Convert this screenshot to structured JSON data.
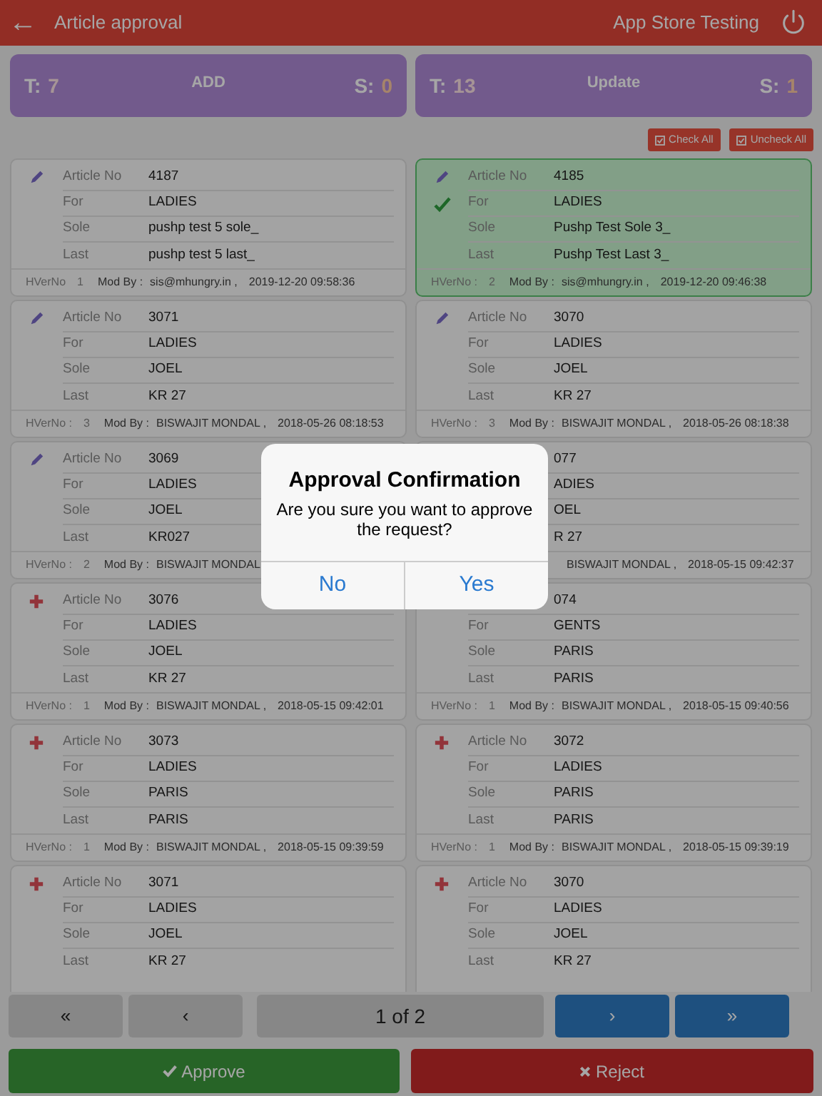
{
  "header": {
    "back": "←",
    "title": "Article approval",
    "user": "App Store Testing"
  },
  "stats": [
    {
      "t_label": "T:",
      "t_value": "7",
      "title": "ADD",
      "s_label": "S:",
      "s_value": "0"
    },
    {
      "t_label": "T:",
      "t_value": "13",
      "title": "Update",
      "s_label": "S:",
      "s_value": "1"
    }
  ],
  "actions": [
    "Check All",
    "Uncheck All"
  ],
  "articles": [
    {
      "kind": "pencil",
      "selected": false,
      "article_label": "Article No",
      "article_no": "4187",
      "rows": [
        {
          "label": "For",
          "value": "LADIES"
        },
        {
          "label": "Sole",
          "value": "pushp test 5 sole_"
        },
        {
          "label": "Last",
          "value": "pushp test 5 last_"
        }
      ],
      "footer": {
        "hver_label": "HVerNo",
        "hver": "1",
        "mod_label": "Mod By :",
        "mod_by": "sis@mhungry.in ,",
        "date": "2019-12-20 09:58:36"
      }
    },
    {
      "kind": "pencil",
      "selected": true,
      "article_label": "Article No",
      "article_no": "4185",
      "rows": [
        {
          "label": "For",
          "value": "LADIES"
        },
        {
          "label": "Sole",
          "value": "Pushp Test Sole 3_"
        },
        {
          "label": "Last",
          "value": "Pushp Test Last 3_"
        }
      ],
      "footer": {
        "hver_label": "HVerNo :",
        "hver": "2",
        "mod_label": "Mod By :",
        "mod_by": "sis@mhungry.in ,",
        "date": "2019-12-20 09:46:38"
      }
    },
    {
      "kind": "pencil",
      "selected": false,
      "article_label": "Article No",
      "article_no": "3071",
      "rows": [
        {
          "label": "For",
          "value": "LADIES"
        },
        {
          "label": "Sole",
          "value": "JOEL"
        },
        {
          "label": "Last",
          "value": "KR 27"
        }
      ],
      "footer": {
        "hver_label": "HVerNo :",
        "hver": "3",
        "mod_label": "Mod By :",
        "mod_by": "BISWAJIT MONDAL ,",
        "date": "2018-05-26 08:18:53"
      }
    },
    {
      "kind": "pencil",
      "selected": false,
      "article_label": "Article No",
      "article_no": "3070",
      "rows": [
        {
          "label": "For",
          "value": "LADIES"
        },
        {
          "label": "Sole",
          "value": "JOEL"
        },
        {
          "label": "Last",
          "value": "KR 27"
        }
      ],
      "footer": {
        "hver_label": "HVerNo :",
        "hver": "3",
        "mod_label": "Mod By :",
        "mod_by": "BISWAJIT MONDAL ,",
        "date": "2018-05-26 08:18:38"
      }
    },
    {
      "kind": "pencil",
      "selected": false,
      "article_label": "Article No",
      "article_no": "3069",
      "rows": [
        {
          "label": "For",
          "value": "LADIES"
        },
        {
          "label": "Sole",
          "value": "JOEL"
        },
        {
          "label": "Last",
          "value": "KR027"
        }
      ],
      "footer": {
        "hver_label": "HVerNo :",
        "hver": "2",
        "mod_label": "Mod By :",
        "mod_by": "BISWAJIT MONDAL"
      }
    },
    {
      "selected": false,
      "article_no": "077",
      "rows": [
        {
          "value": "ADIES"
        },
        {
          "value": "OEL"
        },
        {
          "value": "R 27"
        }
      ],
      "footer": {
        "mod_by": "BISWAJIT MONDAL ,",
        "date": "2018-05-15 09:42:37"
      }
    },
    {
      "kind": "plus",
      "selected": false,
      "article_label": "Article No",
      "article_no": "3076",
      "rows": [
        {
          "label": "For",
          "value": "LADIES"
        },
        {
          "label": "Sole",
          "value": "JOEL"
        },
        {
          "label": "Last",
          "value": "KR 27"
        }
      ],
      "footer": {
        "hver_label": "HVerNo :",
        "hver": "1",
        "mod_label": "Mod By :",
        "mod_by": "BISWAJIT MONDAL ,",
        "date": "2018-05-15 09:42:01"
      }
    },
    {
      "selected": false,
      "article_no": "074",
      "rows": [
        {
          "label": "For",
          "value": "GENTS"
        },
        {
          "label": "Sole",
          "value": "PARIS"
        },
        {
          "label": "Last",
          "value": "PARIS"
        }
      ],
      "footer": {
        "hver_label": "HVerNo :",
        "hver": "1",
        "mod_label": "Mod By :",
        "mod_by": "BISWAJIT MONDAL ,",
        "date": "2018-05-15 09:40:56"
      }
    },
    {
      "kind": "plus",
      "selected": false,
      "article_label": "Article No",
      "article_no": "3073",
      "rows": [
        {
          "label": "For",
          "value": "LADIES"
        },
        {
          "label": "Sole",
          "value": "PARIS"
        },
        {
          "label": "Last",
          "value": "PARIS"
        }
      ],
      "footer": {
        "hver_label": "HVerNo :",
        "hver": "1",
        "mod_label": "Mod By :",
        "mod_by": "BISWAJIT MONDAL ,",
        "date": "2018-05-15 09:39:59"
      }
    },
    {
      "kind": "plus",
      "selected": false,
      "article_label": "Article No",
      "article_no": "3072",
      "rows": [
        {
          "label": "For",
          "value": "LADIES"
        },
        {
          "label": "Sole",
          "value": "PARIS"
        },
        {
          "label": "Last",
          "value": "PARIS"
        }
      ],
      "footer": {
        "hver_label": "HVerNo :",
        "hver": "1",
        "mod_label": "Mod By :",
        "mod_by": "BISWAJIT MONDAL ,",
        "date": "2018-05-15 09:39:19"
      }
    },
    {
      "kind": "plus",
      "selected": false,
      "article_label": "Article No",
      "article_no": "3071",
      "rows": [
        {
          "label": "For",
          "value": "LADIES"
        },
        {
          "label": "Sole",
          "value": "JOEL"
        },
        {
          "label": "Last",
          "value": "KR 27"
        }
      ]
    },
    {
      "kind": "plus",
      "selected": false,
      "article_label": "Article No",
      "article_no": "3070",
      "rows": [
        {
          "label": "For",
          "value": "LADIES"
        },
        {
          "label": "Sole",
          "value": "JOEL"
        },
        {
          "label": "Last",
          "value": "KR 27"
        }
      ]
    }
  ],
  "pagination": {
    "buttons": [
      {
        "label": "«",
        "disabled": true
      },
      {
        "label": "‹",
        "disabled": true
      },
      {
        "label": "›",
        "disabled": false
      },
      {
        "label": "»",
        "disabled": false
      }
    ],
    "page": "1 of 2"
  },
  "approve": "Approve",
  "reject": "Reject",
  "dialog": {
    "title": "Approval Confirmation",
    "message": "Are you sure you want to approve the request?",
    "buttons": [
      "No",
      "Yes"
    ]
  }
}
